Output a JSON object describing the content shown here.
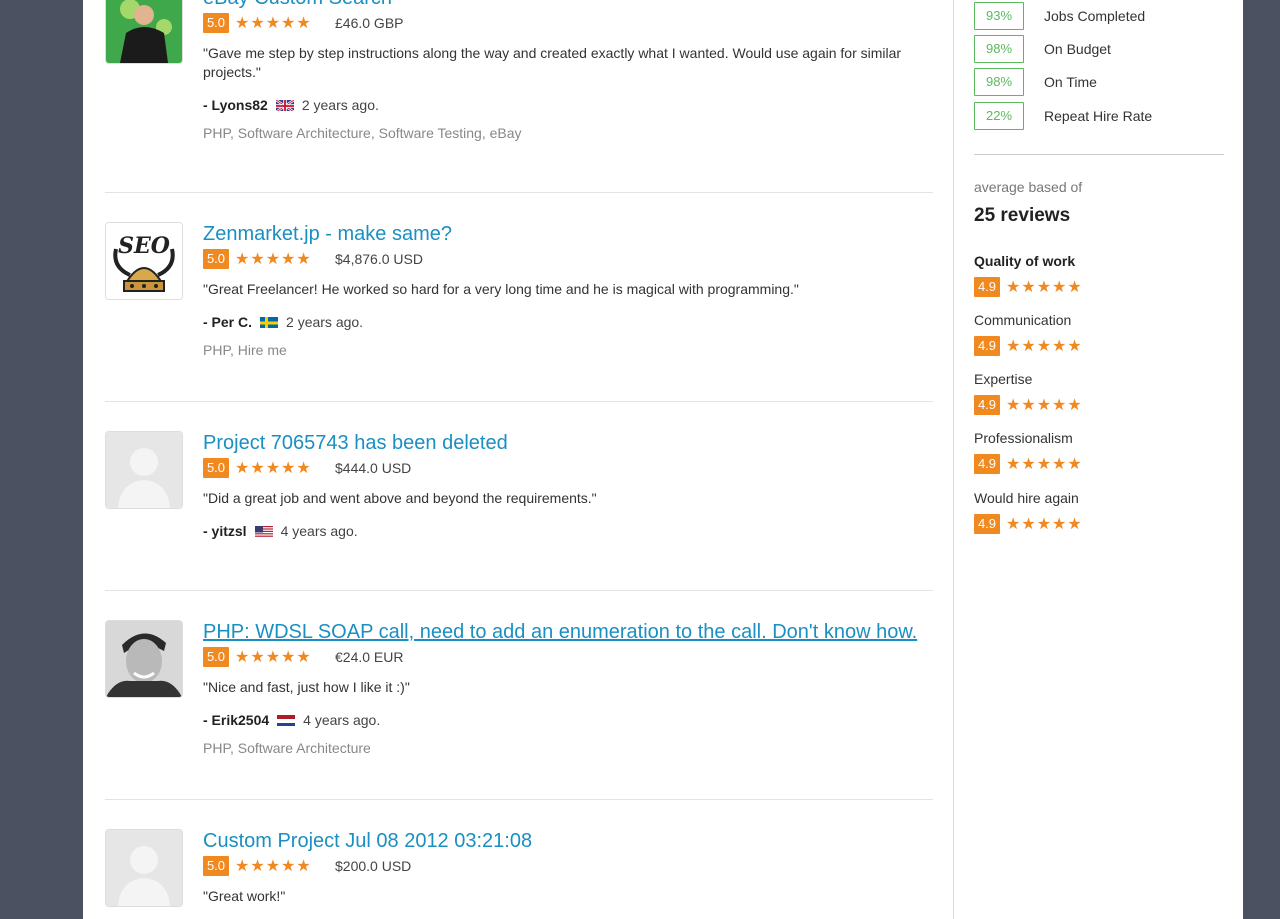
{
  "reviews": [
    {
      "title": "eBay Custom Search",
      "rating": "5.0",
      "stars": "★★★★★",
      "price": "£46.0 GBP",
      "comment": "\"Gave me step by step instructions along the way and created exactly what I wanted. Would use again for similar projects.\"",
      "author": "- Lyons82",
      "flag": "uk-flag-icon",
      "ago": "2 years ago.",
      "skills": "PHP, Software Architecture, Software Testing, eBay"
    },
    {
      "title": "Zenmarket.jp - make same?",
      "rating": "5.0",
      "stars": "★★★★★",
      "price": "$4,876.0 USD",
      "comment": "\"Great Freelancer! He worked so hard for a very long time and he is magical with programming.\"",
      "author": "- Per C.",
      "flag": "sweden-flag-icon",
      "ago": "2 years ago.",
      "skills": "PHP, Hire me"
    },
    {
      "title": "Project 7065743 has been deleted",
      "rating": "5.0",
      "stars": "★★★★★",
      "price": "$444.0 USD",
      "comment": "\"Did a great job and went above and beyond the requirements.\"",
      "author": "- yitzsl",
      "flag": "us-flag-icon",
      "ago": "4 years ago.",
      "skills": ""
    },
    {
      "title": "PHP: WDSL SOAP call, need to add an enumeration to the call. Don't know how.",
      "rating": "5.0",
      "stars": "★★★★★",
      "price": "€24.0 EUR",
      "comment": "\"Nice and fast, just how I like it :)\"",
      "author": "- Erik2504",
      "flag": "netherlands-flag-icon",
      "ago": "4 years ago.",
      "skills": "PHP, Software Architecture"
    },
    {
      "title": "Custom Project Jul 08 2012 03:21:08",
      "rating": "5.0",
      "stars": "★★★★★",
      "price": "$200.0 USD",
      "comment": "\"Great work!\"",
      "author": "",
      "flag": "",
      "ago": "",
      "skills": ""
    }
  ],
  "sidebar": {
    "stats": [
      {
        "pct": "93%",
        "label": "Jobs Completed"
      },
      {
        "pct": "98%",
        "label": "On Budget"
      },
      {
        "pct": "98%",
        "label": "On Time"
      },
      {
        "pct": "22%",
        "label": "Repeat Hire Rate"
      }
    ],
    "avg_label": "average based of",
    "avg_count": "25 reviews",
    "categories": [
      {
        "label": "Quality of work",
        "rating": "4.9",
        "stars": "★★★★★"
      },
      {
        "label": "Communication",
        "rating": "4.9",
        "stars": "★★★★★"
      },
      {
        "label": "Expertise",
        "rating": "4.9",
        "stars": "★★★★★"
      },
      {
        "label": "Professionalism",
        "rating": "4.9",
        "stars": "★★★★★"
      },
      {
        "label": "Would hire again",
        "rating": "4.9",
        "stars": "★★★★★"
      }
    ]
  },
  "colors": {
    "accent": "#f18921",
    "link": "#1a8fc2",
    "stat_green": "#5cb85c",
    "backdrop": "#4b5160"
  }
}
